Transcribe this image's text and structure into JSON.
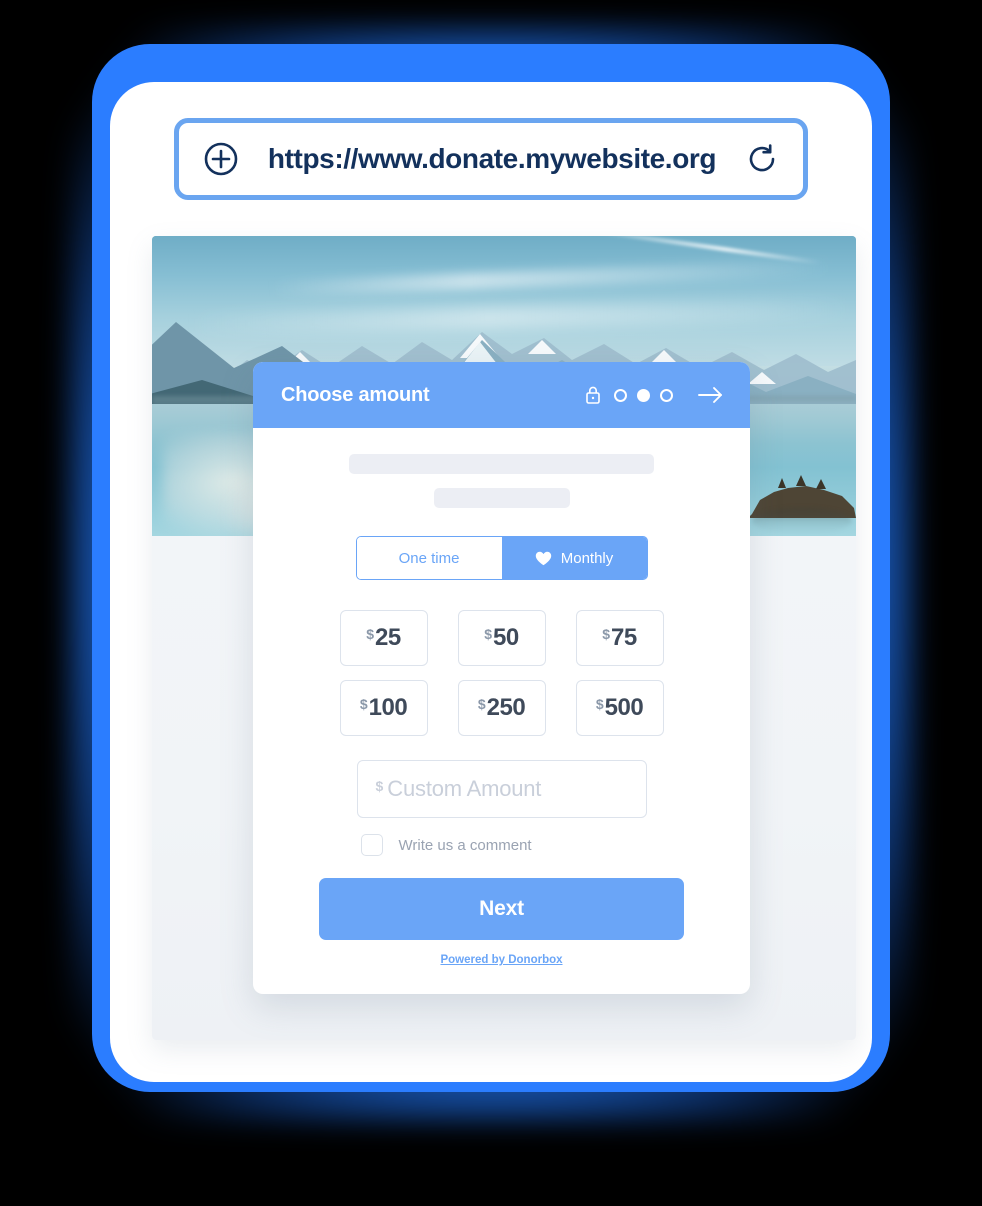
{
  "browser": {
    "url": "https://www.donate.mywebsite.org",
    "add_icon": "plus-circle-icon",
    "reload_icon": "reload-icon"
  },
  "hero": {
    "alt": "lake and snowy mountain landscape photo"
  },
  "modal": {
    "title": "Choose amount",
    "lock_icon": "padlock-icon",
    "next_arrow_icon": "arrow-right-icon",
    "steps": {
      "total": 3,
      "current": 2,
      "states": [
        "empty",
        "filled",
        "empty"
      ]
    },
    "frequency": {
      "options": [
        {
          "label": "One time",
          "selected": false,
          "icon": null
        },
        {
          "label": "Monthly",
          "selected": true,
          "icon": "heart-icon"
        }
      ]
    },
    "currency_symbol": "$",
    "amounts": [
      "25",
      "50",
      "75",
      "100",
      "250",
      "500"
    ],
    "custom_amount": {
      "value": "",
      "placeholder": "Custom Amount",
      "currency_symbol": "$"
    },
    "comment": {
      "label": "Write us a comment",
      "checked": false
    },
    "next_label": "Next",
    "powered_by": "Powered by Donorbox"
  },
  "colors": {
    "glow_blue": "#2b7dff",
    "accent_blue": "#6aa5f7",
    "url_text": "#13315c",
    "amount_text": "#3f4a5a",
    "border_gray": "#dde3ec",
    "skeleton_gray": "#eceef4",
    "page_bg": "#f4f6f9"
  }
}
